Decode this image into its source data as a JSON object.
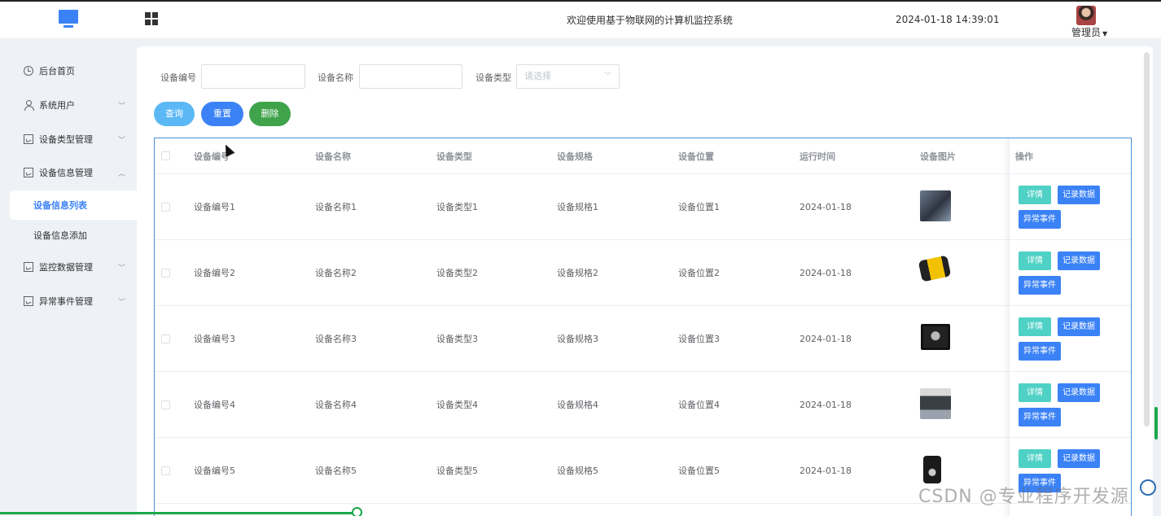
{
  "header": {
    "title": "欢迎使用基于物联网的计算机监控系统",
    "datetime": "2024-01-18 14:39:01",
    "user": "管理员",
    "logo_icon": "monitor-icon",
    "menu_icon": "grid-icon"
  },
  "sidebar": {
    "items": [
      {
        "label": "后台首页",
        "icon": "clock-icon",
        "expanded": false
      },
      {
        "label": "系统用户",
        "icon": "user-icon",
        "expanded": false
      },
      {
        "label": "设备类型管理",
        "icon": "chart-icon",
        "expanded": false
      },
      {
        "label": "设备信息管理",
        "icon": "chart-icon",
        "expanded": true,
        "children": [
          {
            "label": "设备信息列表",
            "active": true
          },
          {
            "label": "设备信息添加",
            "active": false
          }
        ]
      },
      {
        "label": "监控数据管理",
        "icon": "chart-icon",
        "expanded": false
      },
      {
        "label": "异常事件管理",
        "icon": "chart-icon",
        "expanded": false
      }
    ]
  },
  "filters": {
    "code_label": "设备编号",
    "code_value": "",
    "name_label": "设备名称",
    "name_value": "",
    "type_label": "设备类型",
    "type_placeholder": "请选择"
  },
  "actions": {
    "search": "查询",
    "reset": "重置",
    "delete": "删除"
  },
  "table": {
    "columns": [
      "设备编号",
      "设备名称",
      "设备类型",
      "设备规格",
      "设备位置",
      "运行时间",
      "设备图片",
      "操作"
    ],
    "row_buttons": {
      "detail": "详情",
      "record": "记录数据",
      "event": "异常事件"
    },
    "rows": [
      {
        "code": "设备编号1",
        "name": "设备名称1",
        "type": "设备类型1",
        "spec": "设备规格1",
        "location": "设备位置1",
        "time": "2024-01-18"
      },
      {
        "code": "设备编号2",
        "name": "设备名称2",
        "type": "设备类型2",
        "spec": "设备规格2",
        "location": "设备位置2",
        "time": "2024-01-18"
      },
      {
        "code": "设备编号3",
        "name": "设备名称3",
        "type": "设备类型3",
        "spec": "设备规格3",
        "location": "设备位置3",
        "time": "2024-01-18"
      },
      {
        "code": "设备编号4",
        "name": "设备名称4",
        "type": "设备类型4",
        "spec": "设备规格4",
        "location": "设备位置4",
        "time": "2024-01-18"
      },
      {
        "code": "设备编号5",
        "name": "设备名称5",
        "type": "设备类型5",
        "spec": "设备规格5",
        "location": "设备位置5",
        "time": "2024-01-18"
      }
    ]
  },
  "colors": {
    "primary": "#3b82f6",
    "search_btn": "#5bb8f5",
    "delete_btn": "#3ea34a",
    "detail_btn": "#4fd1c5",
    "record_btn": "#3b82f6"
  },
  "watermark": "CSDN @专业程序开发源"
}
